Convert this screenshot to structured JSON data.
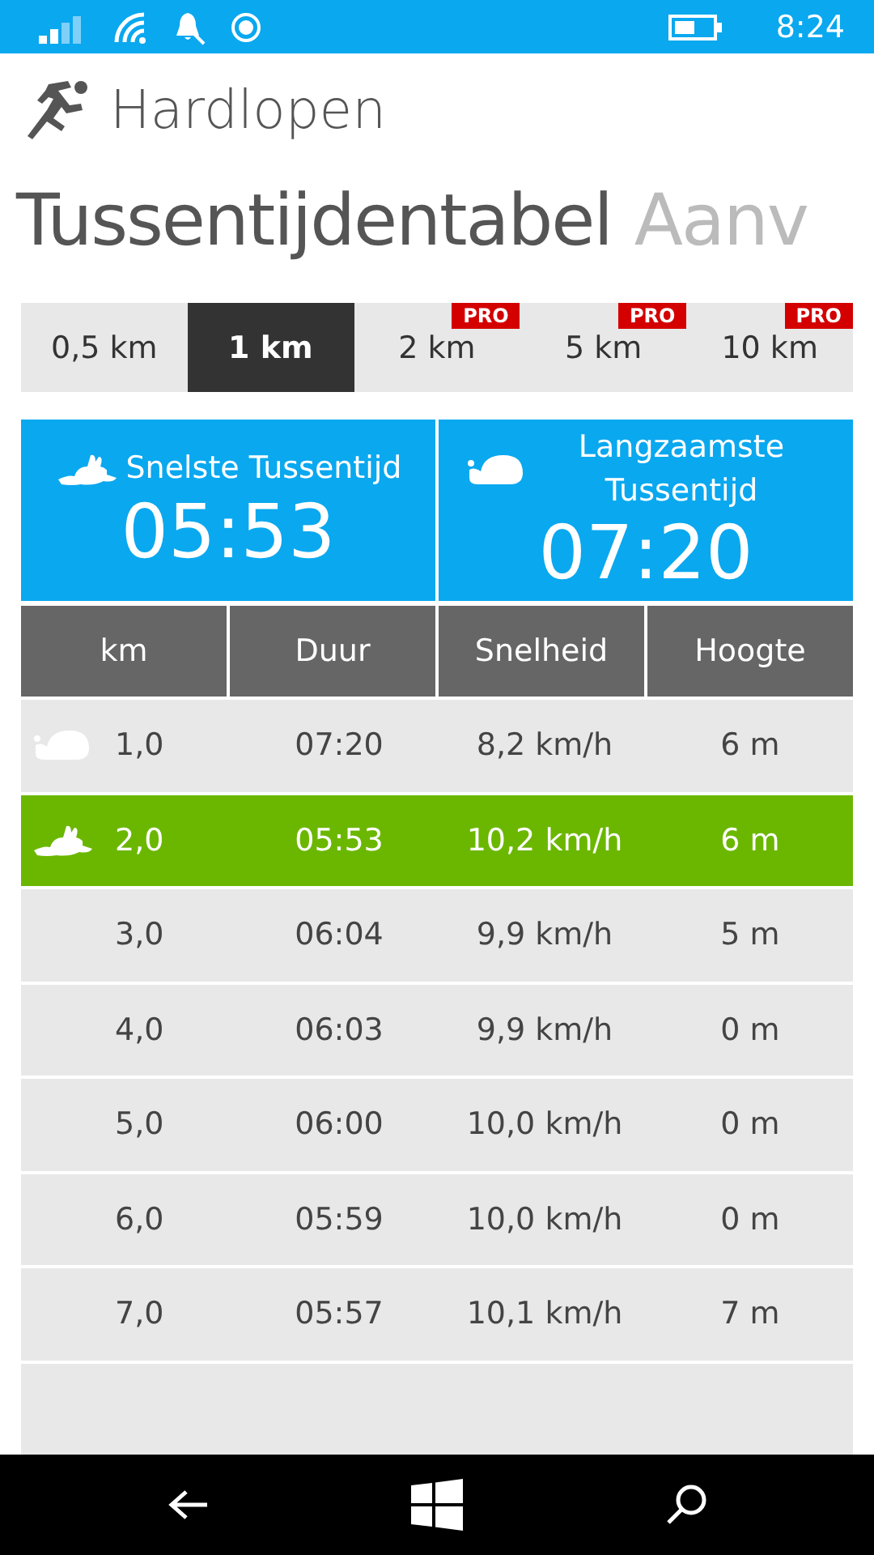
{
  "status_bar": {
    "time": "8:24"
  },
  "app": {
    "title": "Hardlopen"
  },
  "pivot": [
    {
      "label": "Tussentijdentabel",
      "selected": true
    },
    {
      "label": "Aanv",
      "selected": false
    }
  ],
  "distance_tabs": [
    {
      "label": "0,5 km",
      "selected": false
    },
    {
      "label": "1 km",
      "selected": true
    },
    {
      "label": "2 km",
      "selected": false,
      "badge": "PRO"
    },
    {
      "label": "5 km",
      "selected": false,
      "badge": "PRO"
    },
    {
      "label": "10 km",
      "selected": false,
      "badge": "PRO"
    }
  ],
  "summary": [
    {
      "kind": "fastest",
      "label": "Snelste Tussentijd",
      "value": "05:53"
    },
    {
      "kind": "slowest",
      "label": "Langzaamste Tussentijd",
      "value": "07:20"
    }
  ],
  "table": {
    "columns": [
      "km",
      "Duur",
      "Snelheid",
      "Hoogte"
    ],
    "rows": [
      {
        "kind": "slowest",
        "highlighted": false,
        "cells": [
          "1,0",
          "07:20",
          "8,2 km/h",
          "6 m"
        ]
      },
      {
        "kind": "fastest",
        "highlighted": true,
        "cells": [
          "2,0",
          "05:53",
          "10,2 km/h",
          "6 m"
        ]
      },
      {
        "highlighted": false,
        "cells": [
          "3,0",
          "06:04",
          "9,9 km/h",
          "5 m"
        ]
      },
      {
        "highlighted": false,
        "cells": [
          "4,0",
          "06:03",
          "9,9 km/h",
          "0 m"
        ]
      },
      {
        "highlighted": false,
        "cells": [
          "5,0",
          "06:00",
          "10,0 km/h",
          "0 m"
        ]
      },
      {
        "highlighted": false,
        "cells": [
          "6,0",
          "05:59",
          "10,0 km/h",
          "0 m"
        ]
      },
      {
        "highlighted": false,
        "cells": [
          "7,0",
          "05:57",
          "10,1 km/h",
          "7 m"
        ]
      }
    ]
  }
}
